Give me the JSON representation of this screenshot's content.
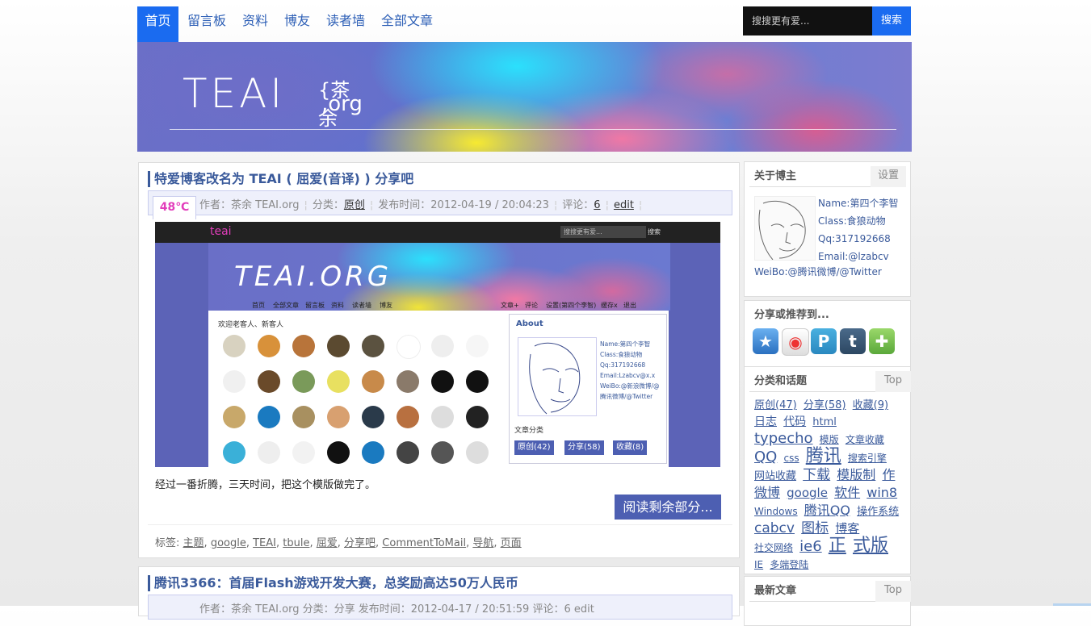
{
  "nav": {
    "items": [
      "首页",
      "留言板",
      "资料",
      "博友",
      "读者墙",
      "全部文章"
    ],
    "search_placeholder": "搜搜更有爱...",
    "search_button": "搜索"
  },
  "banner": {
    "logo_text": "TEAI",
    "logo_cn": "{茶余",
    "logo_org": ",org"
  },
  "post1": {
    "title": "特爱博客改名为 TEAI ( 屈爱(音译) ) 分享吧",
    "temp": "48℃",
    "author": "作者：茶余 TEAI.org",
    "category_label": "分类：",
    "category": "原创",
    "published": "发布时间：2012-04-19 / 20:04:23",
    "comments_label": "评论：",
    "comments": "6",
    "edit": "edit",
    "body": "经过一番折腾，三天时间，把这个模版做完了。",
    "read_more": "阅读剩余部分...",
    "tags_label": "标签:",
    "tags": [
      "主题",
      "google",
      "TEAI",
      "tbule",
      "屈爱",
      "分享吧",
      "CommentToMail",
      "导航",
      "页面"
    ],
    "screenshot": {
      "top_logo": "teai",
      "search": "搜搜更有爱...",
      "search_btn": "搜索",
      "logo": "TEAI.ORG",
      "nav_left": [
        "首页",
        "全部文章",
        "留言板",
        "资料",
        "读者墙",
        "博友"
      ],
      "nav_right": [
        "文章+",
        "评论",
        "设置(第四个李智)",
        "缓存x",
        "退出"
      ],
      "welcome": "欢迎老客人、新客人",
      "about": "About",
      "info": [
        "Name:第四个李智",
        "Class:食狼动物",
        "Qq:317192668",
        "Email:Lzabcv@x.x",
        "WeiBo:@新浪微博/@",
        "腾讯微博/@Twitter"
      ],
      "cat_title": "文章分类",
      "cats": [
        "原创(42)",
        "分享(58)",
        "收藏(8)"
      ]
    }
  },
  "post2": {
    "title": "腾讯3366：首届Flash游戏开发大赛，总奖励高达50万人民币",
    "meta": "作者：茶余 TEAI.org   分类：分享   发布时间：2012-04-17 / 20:51:59   评论：6   edit"
  },
  "sidebar": {
    "about": {
      "title": "关于博主",
      "button": "设置",
      "info": [
        "Name:第四个李智",
        "Class:食狼动物",
        "Qq:317192668",
        "Email:@lzabcv"
      ],
      "weibo": "WeiBo:@腾讯微博/@Twitter"
    },
    "share": {
      "title": "分享或推荐到..."
    },
    "tags": {
      "title": "分类和话题",
      "button": "Top",
      "cloud": [
        [
          "原创(47)",
          13
        ],
        [
          "分享(58)",
          13
        ],
        [
          "收藏(9)",
          13
        ],
        [
          "日志",
          14
        ],
        [
          "代码",
          14
        ],
        [
          "html",
          13
        ],
        [
          "typecho",
          18
        ],
        [
          "模版",
          12
        ],
        [
          "文章收藏",
          12
        ],
        [
          "QQ",
          18
        ],
        [
          "css",
          12
        ],
        [
          "腾讯",
          22
        ],
        [
          "搜索引擎",
          12
        ],
        [
          "网站收藏",
          13
        ],
        [
          "下载",
          17
        ],
        [
          "模版制",
          16
        ],
        [
          "作",
          16
        ],
        [
          "微博",
          16
        ],
        [
          "google",
          15
        ],
        [
          "软件",
          16
        ],
        [
          "win8",
          16
        ],
        [
          "Windows",
          12
        ],
        [
          "腾讯QQ",
          16
        ],
        [
          "操作系统",
          13
        ],
        [
          "cabcv",
          17
        ],
        [
          "图标",
          17
        ],
        [
          "博客",
          15
        ],
        [
          "社交网络",
          12
        ],
        [
          "ie6",
          18
        ],
        [
          "正",
          22
        ],
        [
          "式版",
          22
        ],
        [
          "IE",
          12
        ],
        [
          "多端登陆",
          12
        ]
      ]
    },
    "latest": {
      "title": "最新文章",
      "button": "Top"
    }
  },
  "colors": {
    "accent": "#1a6bf0",
    "link": "#3a5a9b",
    "temp": "#e23dbb",
    "button": "#4d5fb2"
  }
}
